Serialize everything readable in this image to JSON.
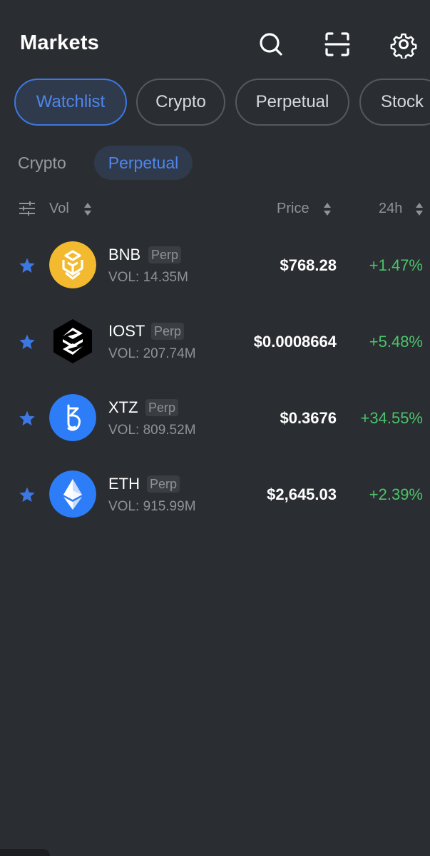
{
  "header": {
    "title": "Markets",
    "icons": [
      "search-icon",
      "scan-icon",
      "gear-icon"
    ]
  },
  "tabs": [
    {
      "label": "Watchlist",
      "active": true
    },
    {
      "label": "Crypto",
      "active": false
    },
    {
      "label": "Perpetual",
      "active": false
    },
    {
      "label": "Stock",
      "active": false
    }
  ],
  "subtabs": [
    {
      "label": "Crypto",
      "active": false
    },
    {
      "label": "Perpetual",
      "active": true
    }
  ],
  "columns": {
    "vol": "Vol",
    "price": "Price",
    "change": "24h"
  },
  "rows": [
    {
      "symbol": "BNB",
      "tag": "Perp",
      "volume": "VOL: 14.35M",
      "price": "$768.28",
      "change": "+1.47%",
      "icon": "bnb-logo-icon"
    },
    {
      "symbol": "IOST",
      "tag": "Perp",
      "volume": "VOL: 207.74M",
      "price": "$0.0008664",
      "change": "+5.48%",
      "icon": "iost-logo-icon"
    },
    {
      "symbol": "XTZ",
      "tag": "Perp",
      "volume": "VOL: 809.52M",
      "price": "$0.3676",
      "change": "+34.55%",
      "icon": "xtz-logo-icon"
    },
    {
      "symbol": "ETH",
      "tag": "Perp",
      "volume": "VOL: 915.99M",
      "price": "$2,645.03",
      "change": "+2.39%",
      "icon": "eth-logo-icon"
    }
  ],
  "colors": {
    "background": "#2a2d31",
    "accent": "#3d78e2",
    "positive": "#4cc36b",
    "muted": "#8e9299"
  }
}
